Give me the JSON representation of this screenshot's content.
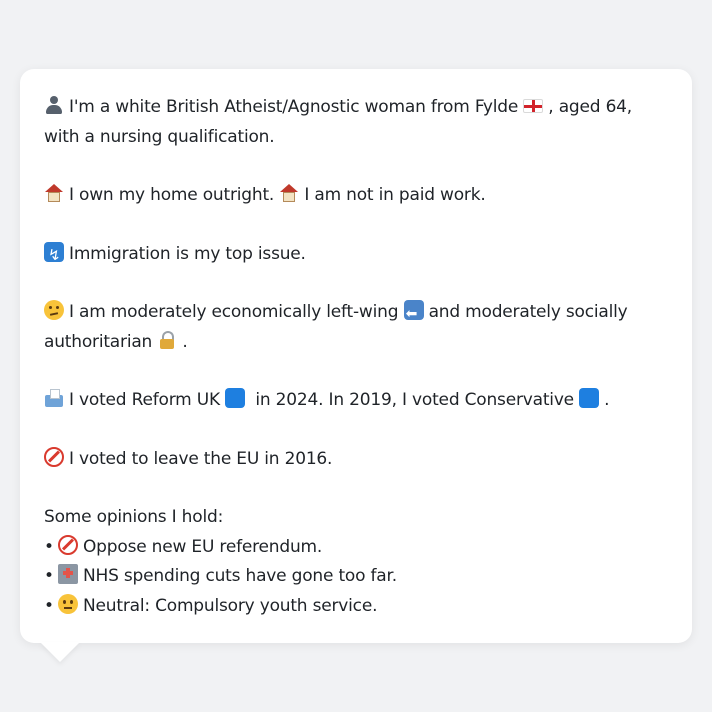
{
  "profile": {
    "line1_a": "I'm a white British Atheist/Agnostic woman from Fylde",
    "line1_b": ", aged 64, with a nursing qualification.",
    "home_a": "I own my home outright.",
    "home_b": "I am not in paid work.",
    "issue": "Immigration is my top issue.",
    "econ_a": "I am moderately economically left-wing",
    "econ_b": "and moderately socially authoritarian",
    "econ_c": ".",
    "vote_a": "I voted Reform UK",
    "vote_b": "in 2024. In 2019, I voted Conservative",
    "vote_c": ".",
    "brexit": "I voted to leave the EU in 2016."
  },
  "opinions": {
    "heading": "Some opinions I hold:",
    "items": [
      {
        "bullet": "•",
        "icon": "no-entry-icon",
        "text": "Oppose new EU referendum."
      },
      {
        "bullet": "•",
        "icon": "hospital-icon",
        "text": "NHS spending cuts have gone too far."
      },
      {
        "bullet": "•",
        "icon": "neutral-face-icon",
        "text": "Neutral: Compulsory youth service."
      }
    ]
  },
  "colors": {
    "background": "#f1f2f4",
    "card": "#ffffff",
    "text": "#1f2328",
    "reform_blue": "#1e7fe0",
    "conservative_blue": "#1e7fe0"
  }
}
